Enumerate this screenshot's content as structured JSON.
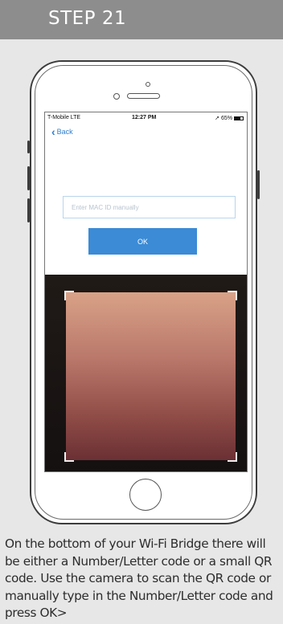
{
  "header": {
    "title": "STEP 21"
  },
  "phone": {
    "status": {
      "carrier": "T-Mobile  LTE",
      "time": "12:27 PM",
      "battery": "65%"
    },
    "back_label": "Back",
    "mac_input": {
      "placeholder": "Enter MAC ID manually",
      "value": ""
    },
    "ok_label": "OK"
  },
  "caption": "On the bottom of your Wi-Fi Bridge there will be either a Number/Letter code or a small QR code.  Use the camera to scan the QR code or manually type in the Number/Letter code and press OK>"
}
